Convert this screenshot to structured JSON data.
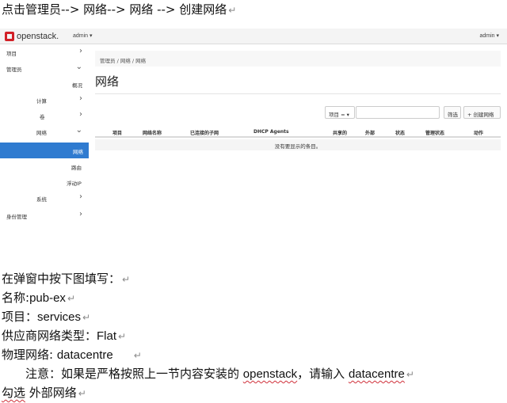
{
  "intro": "点击管理员--> 网络--> 网络 --> 创建网络",
  "screenshot": {
    "logo": "openstack.",
    "project_selector": "admin ▾",
    "user_menu": "admin ▾",
    "sidebar": {
      "project": "项目",
      "admin": "管理员",
      "overview": "概况",
      "compute": "计算",
      "volume": "卷",
      "network": "网络",
      "networks": "网络",
      "routers": "路由",
      "floating_ips": "浮动IP",
      "system": "系统",
      "identity": "身份管理"
    },
    "breadcrumb": "管理员 / 网络 / 网络",
    "page_title": "网络",
    "filter_label": "项目 =",
    "filter_button": "筛选",
    "create_button": "创建网络",
    "table_headers": [
      "项目",
      "网络名称",
      "已连接的子网",
      "DHCP Agents",
      "共享的",
      "外部",
      "状态",
      "管理状态",
      "动作"
    ],
    "empty_message": "没有要显示的条目。"
  },
  "instructions": {
    "line1": "在弹窗中按下图填写：",
    "name_label": "名称:",
    "name_value": "pub-ex",
    "project_label": "项目：",
    "project_value": "services",
    "provider_type_label": "供应商网络类型：",
    "provider_type_value": "Flat",
    "physical_network_label": "物理网络: ",
    "physical_network_value": "datacentre",
    "note_a": "注意：如果是严格按照上一节内容安装的 ",
    "note_b": "openstack",
    "note_c": "，请输入 ",
    "note_d": "datacentre",
    "check_a": "勾选",
    "check_b": " 外部网络"
  },
  "colors": {
    "accent": "#2f7bd0",
    "brand": "#d22027"
  }
}
